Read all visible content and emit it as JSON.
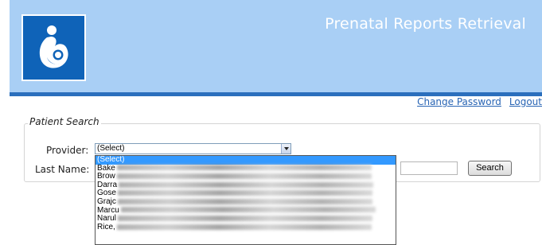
{
  "header": {
    "title": "Prenatal Reports Retrieval",
    "logo_icon": "breastfeeding-mother-icon",
    "background_color": "#a9cff5",
    "bar_color": "#2b6fbd"
  },
  "links": {
    "change_password": "Change Password",
    "logout": "Logout"
  },
  "patient_search": {
    "legend": "Patient Search",
    "provider_label": "Provider:",
    "provider_value": "(Select)",
    "last_name_label": "Last Name:",
    "search_button": "Search"
  },
  "provider_options": [
    "(Select)",
    "Bake",
    "Brow",
    "Darra",
    "Gose",
    "Grajc",
    "Marcu",
    "Narul",
    "Rice,"
  ]
}
